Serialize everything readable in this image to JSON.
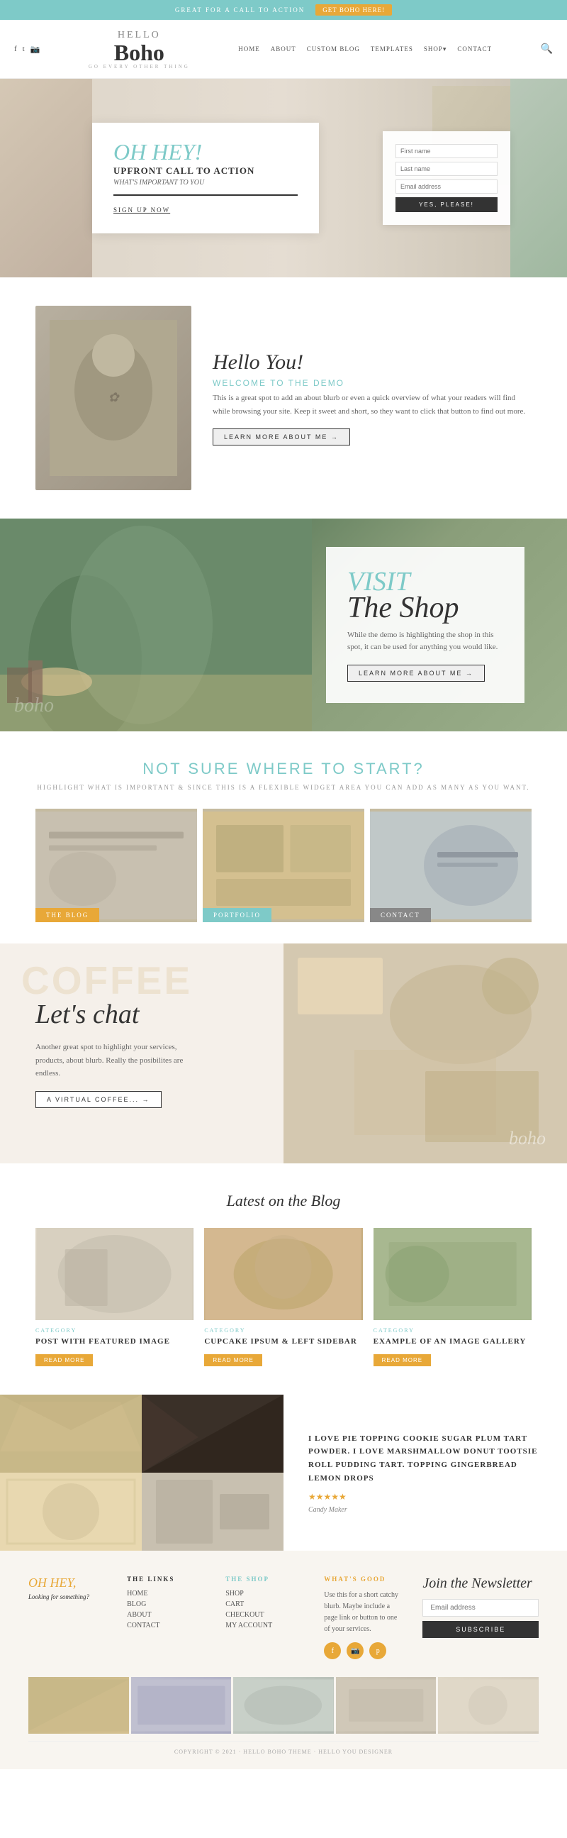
{
  "topBanner": {
    "text": "GREAT FOR A CALL TO ACTION",
    "btnLabel": "Get Boho Here!",
    "colors": {
      "bg": "#7ecac8",
      "btn": "#e8a838"
    }
  },
  "nav": {
    "logoHello": "HELLO",
    "logoBoho": "Boho",
    "tagline": "GO EVERY OTHER THING",
    "links": [
      "HOME",
      "ABOUT",
      "CUSTOM BLOG",
      "TEMPLATES",
      "SHOP",
      "CONTACT"
    ],
    "socialIcons": [
      "f",
      "t",
      "i"
    ]
  },
  "hero": {
    "ohHey": "OH HEY!",
    "headline": "Upfront call to action",
    "subheadline": "WHAT'S IMPORTANT TO YOU",
    "underlineText": "SIGN UP NOW",
    "form": {
      "fields": [
        "First name",
        "Last name",
        "Email address"
      ],
      "submitLabel": "YES, PLEASE!"
    }
  },
  "about": {
    "title": "Hello You!",
    "subtitle": "WELCOME TO THE DEMO",
    "text": "This is a great spot to add an about blurb or even a quick overview of what your readers will find while browsing your site. Keep it sweet and short, so they want to click that button to find out more.",
    "btnLabel": "LEARN MORE ABOUT ME →"
  },
  "shop": {
    "visitLabel": "VISIT",
    "shopLabel": "The Shop",
    "desc": "While the demo is highlighting the shop in this spot, it can be used for anything you would like.",
    "btnLabel": "LEARN MORE ABOUT ME →",
    "watermark": "boho"
  },
  "notSure": {
    "title": "NOT SURE WHERE TO START?",
    "subtitle": "HIGHLIGHT WHAT IS IMPORTANT & SINCE THIS IS A FLEXIBLE WIDGET AREA YOU CAN ADD AS MANY AS YOU WANT.",
    "widgets": [
      {
        "label": "THE BLOG",
        "color": "#e8a838"
      },
      {
        "label": "PORTFOLIO",
        "color": "#7ecac8"
      },
      {
        "label": "CONTACT",
        "color": "#888888"
      }
    ]
  },
  "letsChat": {
    "coffeeText": "COFFEE",
    "title": "Let's chat",
    "desc": "Another great spot to highlight your services, products, about blurb. Really the posibilites are endless.",
    "btnLabel": "A VIRTUAL COFFEE... →",
    "watermark": "boho"
  },
  "blog": {
    "title": "Latest on the Blog",
    "posts": [
      {
        "category": "CATEGORY",
        "title": "POST WITH FEATURED IMAGE",
        "btnLabel": "READ MORE"
      },
      {
        "category": "CATEGORY",
        "title": "CUPCAKE IPSUM & LEFT SIDEBAR",
        "btnLabel": "READ MORE"
      },
      {
        "category": "CATEGORY",
        "title": "EXAMPLE OF AN IMAGE GALLERY",
        "btnLabel": "READ MORE"
      }
    ]
  },
  "testimonial": {
    "text": "I LOVE PIE TOPPING COOKIE SUGAR PLUM TART POWDER. I LOVE MARSHMALLOW DONUT TOOTSIE ROLL PUDDING TART. TOPPING GINGERBREAD LEMON DROPS",
    "stars": "★★★★★",
    "author": "Candy Maker"
  },
  "footer": {
    "ohHey": "OH HEY,",
    "lookingFor": "Looking for something?",
    "linksTitle": "THE LINKS",
    "links": [
      "HOME",
      "BLOG",
      "ABOUT",
      "CONTACT"
    ],
    "shopTitle": "THE SHOP",
    "shopLinks": [
      "SHOP",
      "CART",
      "CHECKOUT",
      "MY ACCOUNT"
    ],
    "whatsGoodTitle": "WHAT'S GOOD",
    "whatsGoodText": "Use this for a short catchy blurb. Maybe include a page link or button to one of your services.",
    "socialIcons": [
      "f",
      "i",
      "p"
    ],
    "newsletterTitle": "Join the Newsletter",
    "emailPlaceholder": "Email address",
    "subscribeLabel": "Subscribe",
    "copyright": "COPYRIGHT © 2021 · HELLO BOHO THEME · HELLO YOU DESIGNER"
  }
}
